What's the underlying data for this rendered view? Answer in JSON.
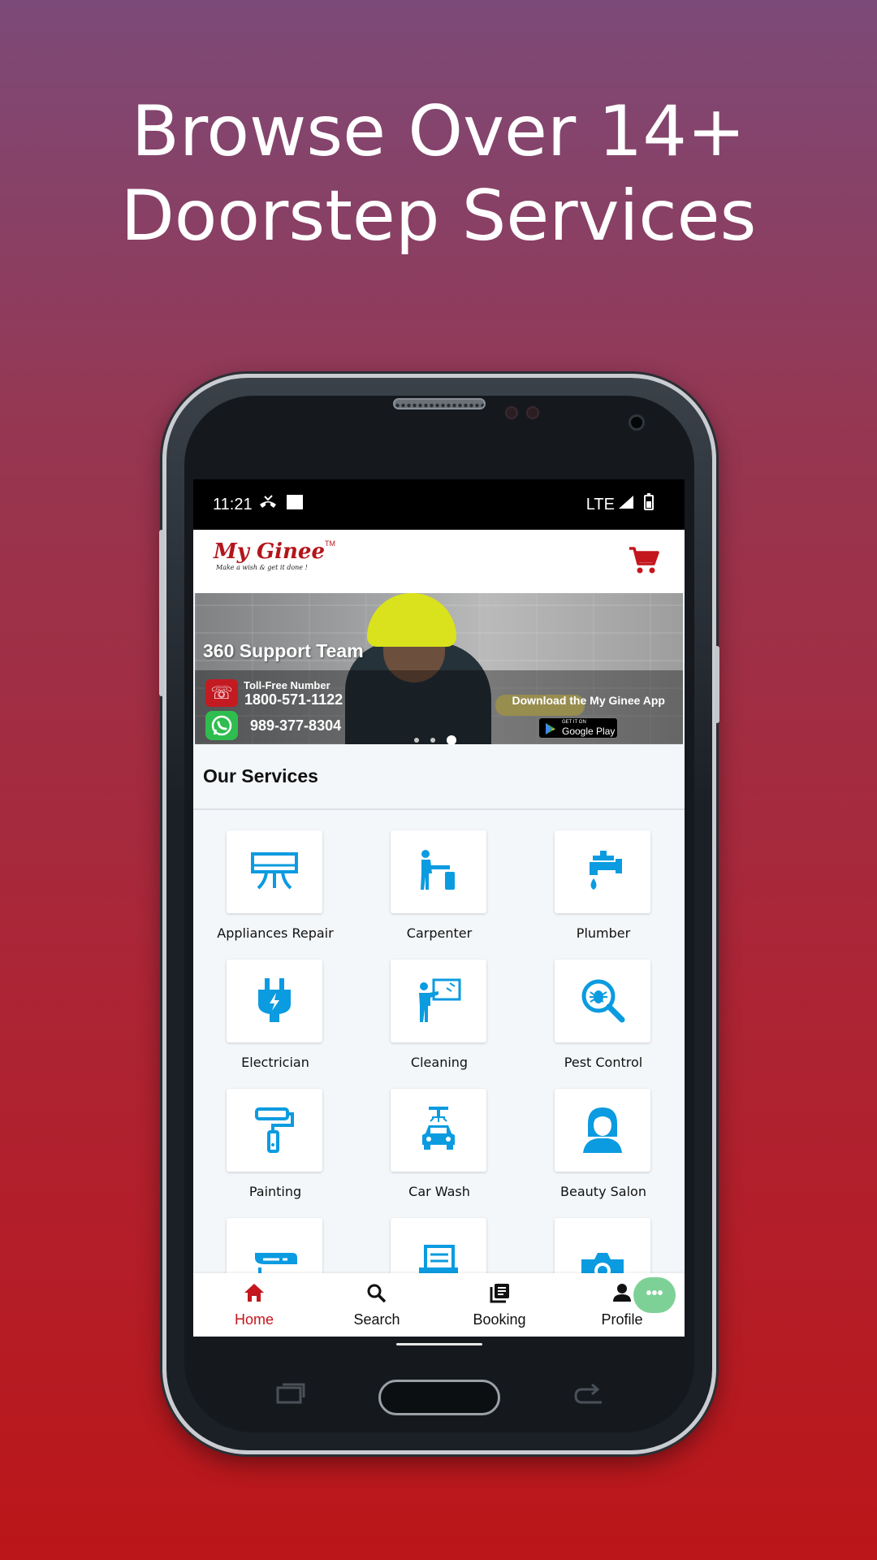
{
  "headline": {
    "line1": "Browse Over 14+",
    "line2": "Doorstep Services"
  },
  "status_bar": {
    "time": "11:21",
    "network": "LTE"
  },
  "app": {
    "logo_text": "My Ginee",
    "logo_tm": "TM",
    "logo_tagline": "Make a wish & get it done !",
    "cart_icon": "shopping-cart-icon"
  },
  "banner": {
    "title": "360 Support Team",
    "toll_free_label": "Toll-Free Number",
    "toll_free_number": "1800-571-1122",
    "whatsapp_number": "989-377-8304",
    "download_text": "Download the My Ginee App",
    "store_small": "GET IT ON",
    "store_name": "Google Play",
    "slides": 3,
    "active_slide": 3
  },
  "services": {
    "title": "Our Services",
    "items": [
      {
        "label": "Appliances Repair",
        "icon": "ac-unit-icon"
      },
      {
        "label": "Carpenter",
        "icon": "carpenter-icon"
      },
      {
        "label": "Plumber",
        "icon": "faucet-icon"
      },
      {
        "label": "Electrician",
        "icon": "plug-icon"
      },
      {
        "label": "Cleaning",
        "icon": "cleaning-icon"
      },
      {
        "label": "Pest Control",
        "icon": "pest-search-icon"
      },
      {
        "label": "Painting",
        "icon": "paint-roller-icon"
      },
      {
        "label": "Car Wash",
        "icon": "car-wash-icon"
      },
      {
        "label": "Beauty Salon",
        "icon": "beauty-woman-icon"
      },
      {
        "label": "",
        "icon": "cctv-icon"
      },
      {
        "label": "",
        "icon": "printer-icon"
      },
      {
        "label": "",
        "icon": "camera-icon"
      }
    ]
  },
  "bottom_nav": {
    "home": "Home",
    "search": "Search",
    "booking": "Booking",
    "profile": "Profile",
    "active": "Home",
    "fab": "•••"
  },
  "colors": {
    "accent_red": "#c4161d",
    "icon_blue": "#0b9be0",
    "fab_green": "#7ed196"
  }
}
